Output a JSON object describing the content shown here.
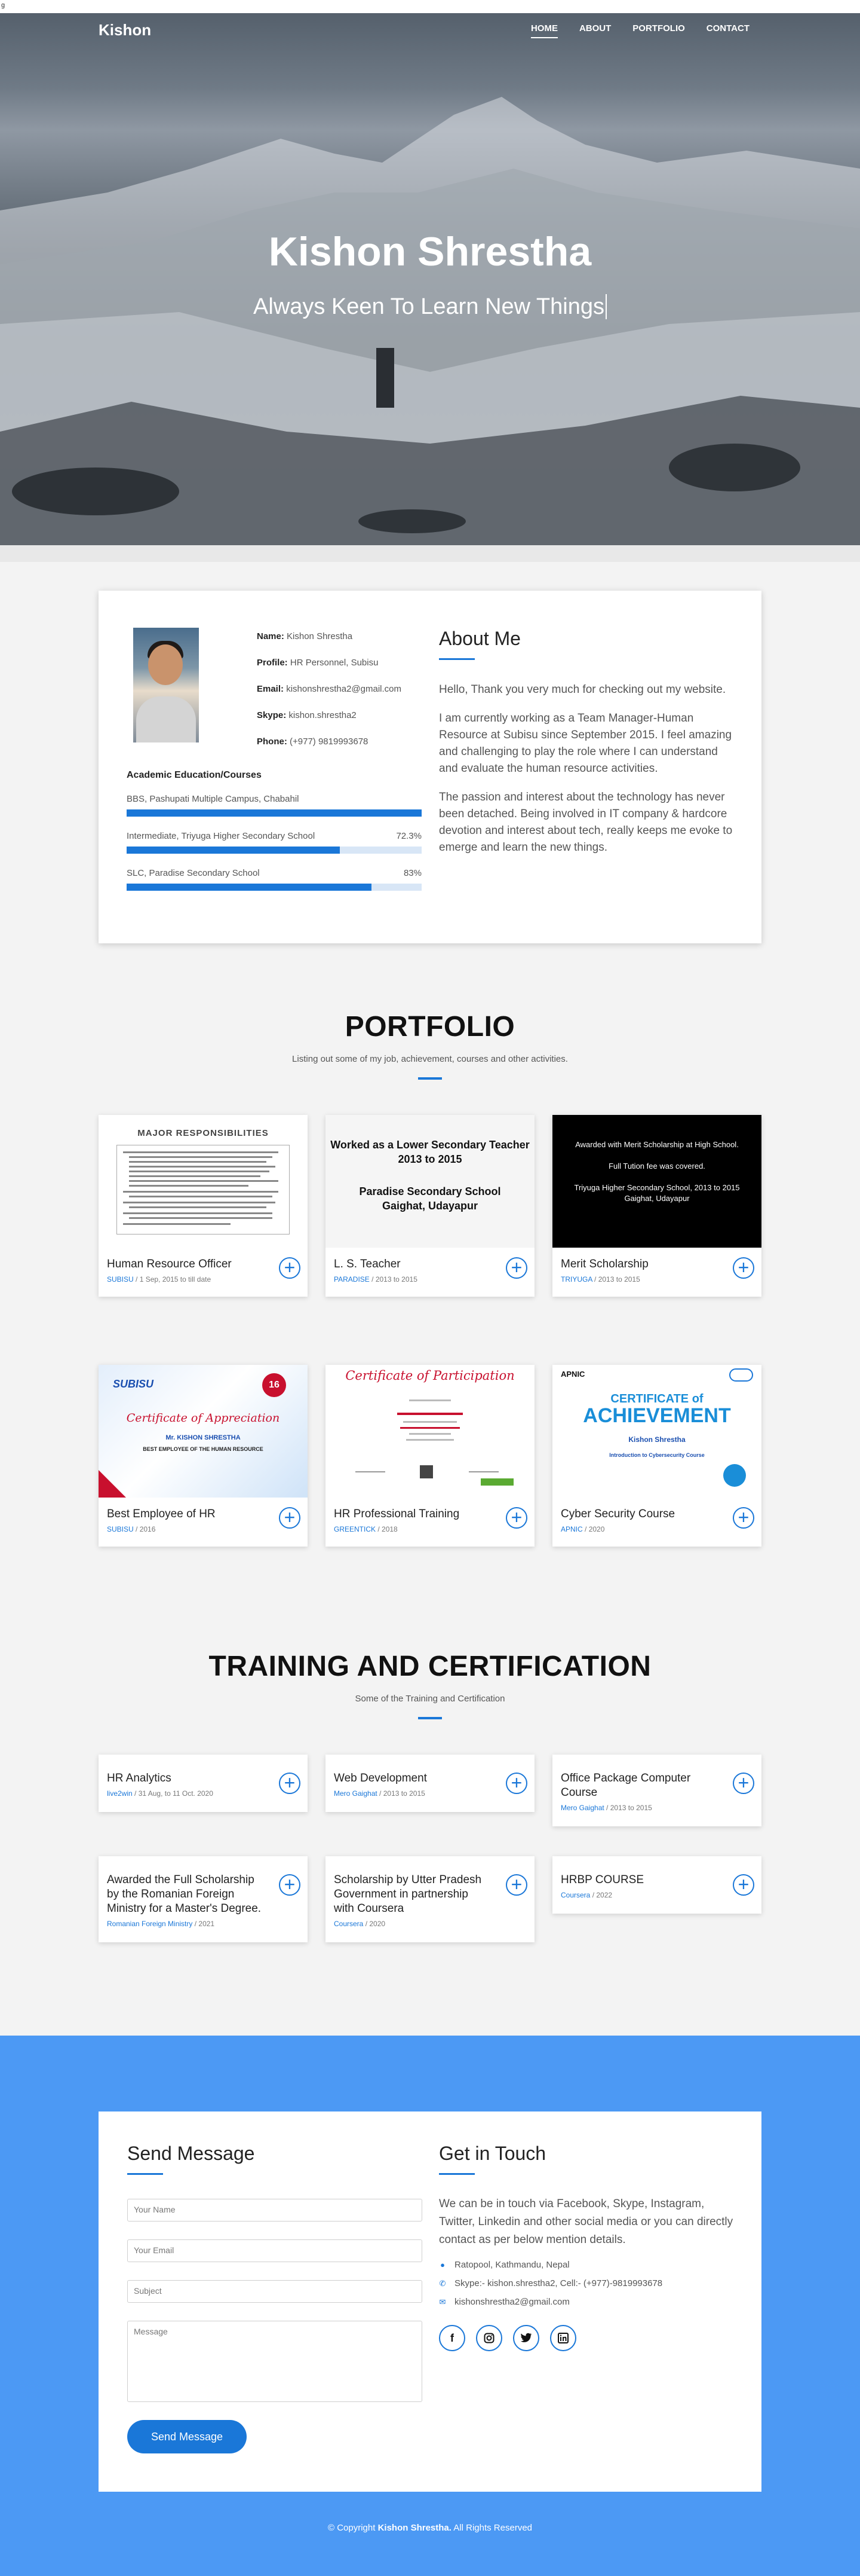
{
  "top_glyph": "g",
  "nav": {
    "brand": "Kishon",
    "items": [
      "HOME",
      "ABOUT",
      "PORTFOLIO",
      "CONTACT"
    ]
  },
  "hero": {
    "name": "Kishon Shrestha",
    "tagline": "Always Keen To Learn New Things"
  },
  "about": {
    "fields": [
      {
        "label": "Name:",
        "value": "Kishon Shrestha"
      },
      {
        "label": "Profile:",
        "value": "HR Personnel, Subisu"
      },
      {
        "label": "Email:",
        "value": "kishonshrestha2@gmail.com"
      },
      {
        "label": "Skype:",
        "value": "kishon.shrestha2"
      },
      {
        "label": "Phone:",
        "value": "(+977) 9819993678"
      }
    ],
    "education_title": "Academic Education/Courses",
    "education": [
      {
        "name": "BBS, Pashupati Multiple Campus, Chabahil",
        "percent_label": "",
        "progress": 1.0
      },
      {
        "name": "Intermediate, Triyuga Higher Secondary School",
        "percent_label": "72.3%",
        "progress": 0.723
      },
      {
        "name": "SLC, Paradise Secondary School",
        "percent_label": "83%",
        "progress": 0.83
      }
    ],
    "title": "About Me",
    "paragraphs": [
      "Hello, Thank you very much for checking out my website.",
      "I am currently working as a Team Manager-Human Resource at Subisu since September 2015. I feel amazing and challenging to play the role where I can understand and evaluate the human resource activities.",
      "The passion and interest about the technology has never been detached. Being involved in IT company & hardcore devotion and interest about tech, really keeps me evoke to emerge and learn the new things."
    ]
  },
  "portfolio": {
    "title": "PORTFOLIO",
    "subtitle": "Listing out some of my job, achievement, courses and other activities.",
    "items": [
      {
        "title": "Human Resource Officer",
        "org": "SUBISU",
        "date": "1 Sep, 2015 to till date",
        "thumb": {
          "heading": "MAJOR RESPONSIBILITIES"
        }
      },
      {
        "title": "L. S. Teacher",
        "org": "PARADISE",
        "date": "2013 to 2015",
        "thumb": {
          "line1": "Worked as a Lower Secondary Teacher",
          "line2": "2013 to 2015",
          "line3": "Paradise Secondary School",
          "line4": "Gaighat, Udayapur"
        }
      },
      {
        "title": "Merit Scholarship",
        "org": "TRIYUGA",
        "date": "2013 to 2015",
        "thumb": {
          "line1": "Awarded with Merit Scholarship at High School.",
          "line2": "Full Tution fee was covered.",
          "line3": "Triyuga Higher Secondary School, 2013 to 2015",
          "line4": "Gaighat, Udayapur"
        }
      },
      {
        "title": "Best Employee of HR",
        "org": "SUBISU",
        "date": "2016",
        "thumb": {
          "logo": "SUBISU",
          "badge": "16",
          "title": "Certificate of Appreciation",
          "name": "Mr. KISHON SHRESTHA",
          "sub": "BEST EMPLOYEE OF THE HUMAN RESOURCE"
        }
      },
      {
        "title": "HR Professional Training",
        "org": "GREENTICK",
        "date": "2018",
        "thumb": {
          "title": "Certificate of Participation"
        }
      },
      {
        "title": "Cyber Security Course",
        "org": "APNIC",
        "date": "2020",
        "thumb": {
          "logo": "APNIC",
          "line1": "CERTIFICATE of",
          "line2": "ACHIEVEMENT",
          "name": "Kishon Shrestha",
          "course": "Introduction to Cybersecurity Course"
        }
      }
    ]
  },
  "training": {
    "title": "TRAINING AND CERTIFICATION",
    "subtitle": "Some of the Training and Certification",
    "items": [
      {
        "title": "HR Analytics",
        "org": "live2win",
        "date": "31 Aug, to 11 Oct. 2020"
      },
      {
        "title": "Web Development",
        "org": "Mero Gaighat",
        "date": "2013 to 2015"
      },
      {
        "title": "Office Package Computer Course",
        "org": "Mero Gaighat",
        "date": "2013 to 2015"
      },
      {
        "title": "Awarded the Full Scholarship by the Romanian Foreign Ministry for a Master's Degree.",
        "org": "Romanian Foreign Ministry",
        "date": "2021"
      },
      {
        "title": "Scholarship by Utter Pradesh Government in partnership with Coursera",
        "org": "Coursera",
        "date": "2020"
      },
      {
        "title": "HRBP COURSE",
        "org": "Coursera",
        "date": "2022"
      }
    ]
  },
  "contact": {
    "form_title": "Send Message",
    "name_placeholder": "Your Name",
    "email_placeholder": "Your Email",
    "subject_placeholder": "Subject",
    "message_placeholder": "Message",
    "send_label": "Send Message",
    "touch_title": "Get in Touch",
    "touch_text": "We can be in touch via Facebook, Skype, Instagram, Twitter, Linkedin and other social media or you can directly contact as per below mention details.",
    "address": "Ratopool, Kathmandu, Nepal",
    "skype_phone": "Skype:- kishon.shrestha2, Cell:- (+977)-9819993678",
    "email": "kishonshrestha2@gmail.com",
    "socials": [
      "facebook-icon",
      "instagram-icon",
      "twitter-icon",
      "linkedin-icon"
    ]
  },
  "footer": {
    "prefix": "© Copyright",
    "name": "Kishon Shrestha.",
    "suffix": "All Rights Reserved"
  },
  "colors": {
    "accent": "#1a77d8",
    "contact_bg": "#4c99f4"
  }
}
